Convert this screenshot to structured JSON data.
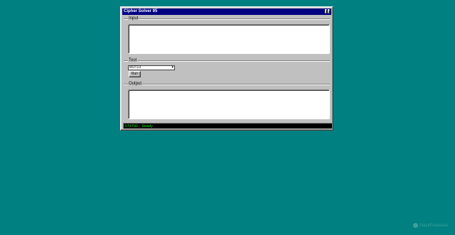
{
  "window": {
    "title": "Cipher Solver 95",
    "controls": [
      "?",
      "×"
    ]
  },
  "input": {
    "legend": "Input",
    "value": ""
  },
  "tool": {
    "legend": "Tool",
    "selected": "ROT13",
    "run_label": "Run"
  },
  "output": {
    "legend": "Output",
    "value": ""
  },
  "status": {
    "text": "STATUS: Ready"
  },
  "watermark": {
    "text": "StackFreeware"
  },
  "colors": {
    "desktop": "#008080",
    "titlebar": "#000080",
    "status_fg": "#00ff00",
    "status_bg": "#000000"
  },
  "icons": {
    "select_arrow": "chevron-down-icon",
    "watermark_logo": "logo-icon"
  }
}
